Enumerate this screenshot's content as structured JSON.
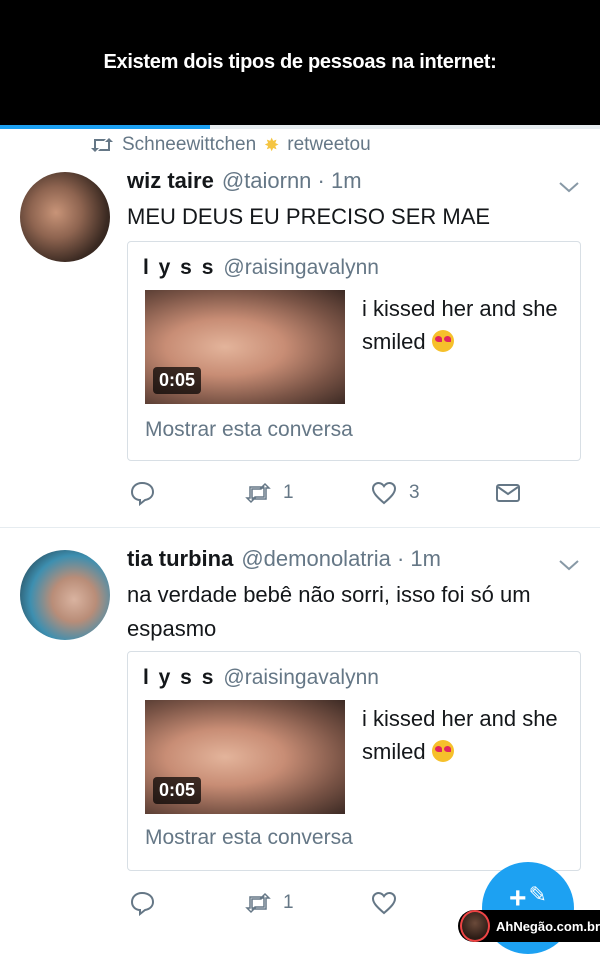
{
  "banner": {
    "title": "Existem dois tipos de pessoas na internet:"
  },
  "progress": {
    "fraction": 0.35
  },
  "retweet": {
    "user": "Schneewittchen",
    "action": "retweetou"
  },
  "tweets": [
    {
      "name": "wiz taire",
      "handle": "@taiornn · 1m",
      "text": "MEU DEUS EU PRECISO SER MAE",
      "quote": {
        "name": "l y s s",
        "handle": "@raisingavalynn",
        "duration": "0:05",
        "text": "i kissed her and she smiled",
        "show": "Mostrar esta conversa"
      },
      "retweets": "1",
      "likes": "3"
    },
    {
      "name": "tia turbina",
      "handle": "@demonolatria · 1m",
      "text": "na verdade bebê não sorri, isso foi só um espasmo",
      "quote": {
        "name": "l y s s",
        "handle": "@raisingavalynn",
        "duration": "0:05",
        "text": "i kissed her and she smiled",
        "show": "Mostrar esta conversa"
      },
      "retweets": "1"
    }
  ],
  "fab": {
    "label": "+"
  },
  "watermark": {
    "text": "AhNegão.com.br"
  },
  "colors": {
    "accent": "#1da1f2",
    "secondary_text": "#657786",
    "banner_bg": "#000000"
  }
}
